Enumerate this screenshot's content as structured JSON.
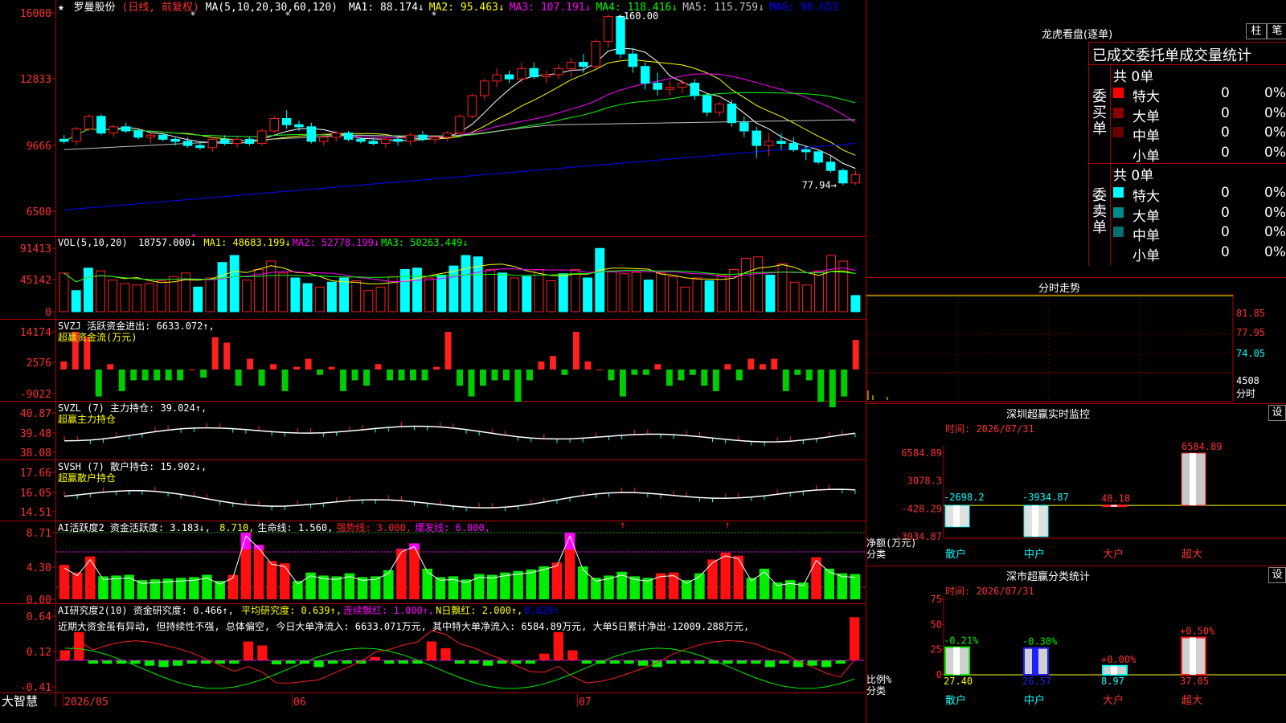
{
  "stock": {
    "star": "★",
    "name": "罗曼股份",
    "period": "(日线, 前复权)"
  },
  "price_panel": {
    "ma_header": "MA(5,10,20,30,60,120)",
    "ma_values": [
      {
        "label": "MA1: 88.174↓",
        "color": "#ffffff"
      },
      {
        "label": "MA2: 95.463↓",
        "color": "#ffff00"
      },
      {
        "label": "MA3: 107.191↓",
        "color": "#ff00ff"
      },
      {
        "label": "MA4: 118.416↓",
        "color": "#00ff00"
      },
      {
        "label": "MA5: 115.759↓",
        "color": "#c0c0c0"
      },
      {
        "label": "MA6: 98.653",
        "color": "#0000ff"
      }
    ],
    "y_labels": [
      "16000",
      "12833",
      "9666",
      "6500"
    ],
    "high_label": "160.00",
    "low_label": "77.94"
  },
  "volume_panel": {
    "header": "VOL(5,10,20)",
    "value": "18757.000↓",
    "ma_values": [
      {
        "label": "MA1: 48683.199↓",
        "color": "#ffff00"
      },
      {
        "label": "MA2: 52778.199↓",
        "color": "#ff00ff"
      },
      {
        "label": "MA3: 50263.449↓",
        "color": "#00ff00"
      }
    ],
    "y_labels": [
      "91413",
      "45142",
      "0"
    ]
  },
  "svzj_panel": {
    "header": "SVZJ  活跃资金进出: 6633.072↑,",
    "subtitle": "超赢资金流(万元)",
    "y_labels": [
      "14174",
      "2576",
      "-9022"
    ]
  },
  "svzl_panel": {
    "header": "SVZL (7) 主力持仓: 39.024↑,",
    "subtitle": "超赢主力持仓",
    "y_labels": [
      "40.87",
      "39.48",
      "38.08"
    ]
  },
  "svsh_panel": {
    "header": "SVSH (7) 散户持仓: 15.902↓,",
    "subtitle": "超赢散户持仓",
    "y_labels": [
      "17.66",
      "16.05",
      "14.51"
    ]
  },
  "ai_active_panel": {
    "header": "AI活跃度2 资金活跃度: 3.183↓,",
    "parts": [
      {
        "text": "8.710,",
        "color": "#ffff00"
      },
      {
        "text": "生命线: 1.560,",
        "color": "#ffffff"
      },
      {
        "text": "强势线: 3.000,",
        "color": "#ff2222"
      },
      {
        "text": "爆发线: 6.000,",
        "color": "#ff00ff"
      }
    ],
    "y_labels": [
      "8.71",
      "4.30",
      "0.00"
    ]
  },
  "ai_research_panel": {
    "header": "AI研究度2(10) 资金研究度: 0.466↑,",
    "parts": [
      {
        "text": "平均研究度: 0.639↑,",
        "color": "#ffff00"
      },
      {
        "text": "连续飘红: 1.000↑,",
        "color": "#ff00ff"
      },
      {
        "text": "N日飘红: 2.000↑,",
        "color": "#ffff00"
      },
      {
        "text": "0.639↑",
        "color": "#0000ff"
      }
    ],
    "commentary": "近期大资金虽有异动, 但持续性不强, 总体偏空, 今日大单净流入: 6633.071万元, 其中特大单净流入: 6584.89万元, 大单5日累计净出-12009.288万元,",
    "y_labels": [
      "0.64",
      "0.12",
      "-0.41"
    ]
  },
  "bottom_bar": {
    "brand": "大智慧",
    "dates": [
      "2026/05",
      "06",
      "07"
    ]
  },
  "right_panel": {
    "title": "龙虎看盘(逐单)",
    "btn_zhu": "柱",
    "btn_bi": "笔",
    "subtitle": "已成交委托单成交量统计",
    "buy": {
      "label": "委买单",
      "total": "共 0单",
      "rows": [
        {
          "name": "特大",
          "qty": "0",
          "pct": "0%",
          "color": "#ff0000"
        },
        {
          "name": "大单",
          "qty": "0",
          "pct": "0%",
          "color": "#8b0000"
        },
        {
          "name": "中单",
          "qty": "0",
          "pct": "0%",
          "color": "#6b0000"
        },
        {
          "name": "小单",
          "qty": "0",
          "pct": "0%",
          "color": ""
        }
      ]
    },
    "sell": {
      "label": "委卖单",
      "total": "共 0单",
      "rows": [
        {
          "name": "特大",
          "qty": "0",
          "pct": "0%",
          "color": "#00ffff"
        },
        {
          "name": "大单",
          "qty": "0",
          "pct": "0%",
          "color": "#008b8b"
        },
        {
          "name": "中单",
          "qty": "0",
          "pct": "0%",
          "color": "#007070"
        },
        {
          "name": "小单",
          "qty": "0",
          "pct": "0%",
          "color": ""
        }
      ]
    },
    "intraday": {
      "title": "分时走势",
      "y_labels": [
        "81.85",
        "77.95",
        "74.05",
        "4508",
        "分时"
      ]
    },
    "sz_monitor": {
      "title": "深圳超赢实时监控",
      "btn": "设",
      "time": "时间: 2026/07/31",
      "y_labels": [
        "6584.89",
        "3078.3",
        "-428.29",
        "-3934.87"
      ],
      "axis_note1": "净额(万元)",
      "axis_note2": "分类",
      "bars": [
        {
          "cat": "散户",
          "value": -2698.2,
          "label": "-2698.2"
        },
        {
          "cat": "中户",
          "value": -3934.87,
          "label": "-3934.87"
        },
        {
          "cat": "大户",
          "value": 48.18,
          "label": "48.18"
        },
        {
          "cat": "超大",
          "value": 6584.89,
          "label": "6584.89"
        }
      ]
    },
    "sz_class": {
      "title": "深市超赢分类统计",
      "btn": "设",
      "time": "时间: 2026/07/31",
      "y_labels": [
        "75",
        "50",
        "25",
        "0"
      ],
      "axis_note1": "比例%",
      "axis_note2": "分类",
      "bars": [
        {
          "cat": "散户",
          "value": 27.4,
          "label": "27.40",
          "change": "-0.21%"
        },
        {
          "cat": "中户",
          "value": 26.57,
          "label": "26.57",
          "change": "-0.30%"
        },
        {
          "cat": "大户",
          "value": 8.97,
          "label": "8.97",
          "change": "+0.00%"
        },
        {
          "cat": "超大",
          "value": 37.05,
          "label": "37.05",
          "change": "+0.50%"
        }
      ]
    }
  },
  "chart_data": [
    {
      "type": "candlestick",
      "title": "罗曼股份 (日线, 前复权)",
      "y_range": [
        6500,
        16000
      ],
      "ohlc": [
        [
          100,
          102,
          98,
          99
        ],
        [
          99,
          106,
          97,
          105
        ],
        [
          105,
          112,
          104,
          111
        ],
        [
          111,
          112,
          102,
          103
        ],
        [
          103,
          107,
          101,
          106
        ],
        [
          106,
          108,
          103,
          104
        ],
        [
          104,
          105,
          100,
          101
        ],
        [
          101,
          103,
          98,
          102
        ],
        [
          102,
          103,
          99,
          100
        ],
        [
          100,
          101,
          97,
          99
        ],
        [
          99,
          101,
          96,
          97
        ],
        [
          97,
          99,
          95,
          96
        ],
        [
          96,
          101,
          94,
          100
        ],
        [
          100,
          102,
          97,
          98
        ],
        [
          98,
          101,
          96,
          100
        ],
        [
          100,
          101,
          97,
          98
        ],
        [
          98,
          105,
          97,
          104
        ],
        [
          104,
          111,
          103,
          110
        ],
        [
          110,
          114,
          105,
          107
        ],
        [
          107,
          109,
          104,
          106
        ],
        [
          106,
          108,
          98,
          99
        ],
        [
          99,
          103,
          97,
          101
        ],
        [
          101,
          104,
          99,
          103
        ],
        [
          103,
          104,
          99,
          100
        ],
        [
          100,
          101,
          98,
          99
        ],
        [
          99,
          101,
          97,
          98
        ],
        [
          98,
          101,
          96,
          100
        ],
        [
          100,
          102,
          97,
          99
        ],
        [
          99,
          103,
          97,
          102
        ],
        [
          102,
          104,
          99,
          100
        ],
        [
          100,
          102,
          98,
          101
        ],
        [
          101,
          104,
          99,
          103
        ],
        [
          103,
          112,
          102,
          111
        ],
        [
          111,
          122,
          110,
          121
        ],
        [
          121,
          129,
          119,
          128
        ],
        [
          128,
          134,
          125,
          131
        ],
        [
          131,
          133,
          127,
          129
        ],
        [
          129,
          137,
          127,
          134
        ],
        [
          134,
          137,
          129,
          130
        ],
        [
          130,
          133,
          127,
          131
        ],
        [
          131,
          136,
          129,
          134
        ],
        [
          134,
          139,
          130,
          137
        ],
        [
          137,
          141,
          132,
          135
        ],
        [
          135,
          148,
          134,
          147
        ],
        [
          147,
          160,
          144,
          159
        ],
        [
          159,
          160,
          139,
          141
        ],
        [
          141,
          144,
          132,
          135
        ],
        [
          135,
          137,
          124,
          127
        ],
        [
          127,
          132,
          121,
          124
        ],
        [
          124,
          128,
          121,
          125
        ],
        [
          125,
          129,
          122,
          127
        ],
        [
          127,
          129,
          119,
          121
        ],
        [
          121,
          122,
          111,
          113
        ],
        [
          113,
          118,
          111,
          117
        ],
        [
          117,
          119,
          106,
          108
        ],
        [
          108,
          111,
          101,
          104
        ],
        [
          104,
          106,
          91,
          97
        ],
        [
          97,
          103,
          92,
          99
        ],
        [
          99,
          103,
          95,
          98
        ],
        [
          98,
          101,
          94,
          95
        ],
        [
          95,
          97,
          90,
          94
        ],
        [
          94,
          95,
          88,
          89
        ],
        [
          89,
          92,
          84,
          85
        ],
        [
          85,
          86,
          77.94,
          79
        ],
        [
          79,
          85,
          78,
          83
        ]
      ],
      "ma_series": [
        "MA1",
        "MA2",
        "MA3",
        "MA4",
        "MA5",
        "MA6"
      ]
    },
    {
      "type": "bar",
      "title": "VOL(5,10,20)",
      "values": [
        55,
        30,
        62,
        58,
        45,
        40,
        38,
        40,
        44,
        50,
        55,
        35,
        48,
        70,
        80,
        45,
        60,
        72,
        55,
        48,
        40,
        35,
        42,
        48,
        44,
        30,
        35,
        50,
        60,
        62,
        48,
        52,
        65,
        80,
        78,
        60,
        55,
        48,
        50,
        60,
        44,
        54,
        60,
        48,
        90,
        58,
        54,
        56,
        45,
        55,
        50,
        35,
        48,
        44,
        52,
        60,
        76,
        78,
        52,
        68,
        42,
        38,
        58,
        80,
        72,
        23
      ],
      "up": [
        false,
        true,
        true,
        false,
        false,
        false,
        false,
        false,
        false,
        false,
        false,
        true,
        false,
        true,
        true,
        false,
        false,
        false,
        false,
        true,
        true,
        false,
        true,
        true,
        false,
        false,
        false,
        false,
        true,
        true,
        false,
        true,
        true,
        true,
        true,
        false,
        true,
        false,
        true,
        false,
        false,
        true,
        false,
        true,
        true,
        false,
        false,
        false,
        true,
        false,
        false,
        false,
        false,
        true,
        false,
        false,
        false,
        false,
        true,
        false,
        false,
        false,
        false,
        false,
        false,
        true
      ]
    },
    {
      "type": "bar",
      "title": "SVZJ 活跃资金进出",
      "values": [
        3,
        14,
        12,
        -10,
        2,
        -8,
        -4,
        -4,
        -4,
        -4,
        -4,
        0,
        -3,
        12,
        10,
        -6,
        4,
        -6,
        2,
        -8,
        1,
        4,
        -2,
        1,
        -8,
        -4,
        -6,
        2,
        -4,
        -4,
        -4,
        -4,
        1,
        14,
        -6,
        -10,
        -6,
        -4,
        -4,
        -12,
        -4,
        3,
        5,
        -2,
        14,
        3,
        0,
        -4,
        -10,
        -2,
        -2,
        2,
        -6,
        -4,
        -2,
        -6,
        -8,
        2,
        -4,
        4,
        2,
        4,
        -8,
        -2,
        -4,
        -12,
        -14,
        -10,
        11
      ]
    },
    {
      "type": "line",
      "title": "SVZL 主力持仓",
      "y_range": [
        38.08,
        40.87
      ]
    },
    {
      "type": "line",
      "title": "SVSH 散户持仓",
      "y_range": [
        14.51,
        17.66
      ]
    },
    {
      "type": "bar",
      "title": "AI活跃度2",
      "values": [
        4.5,
        3.5,
        5.6,
        3.0,
        3.1,
        3.2,
        2.5,
        2.6,
        2.7,
        2.8,
        2.9,
        3.2,
        2.4,
        3.2,
        8.7,
        7.1,
        5.0,
        4.7,
        2.4,
        3.5,
        3.1,
        3.0,
        3.4,
        2.9,
        3.0,
        3.8,
        6.6,
        7.3,
        4.0,
        2.9,
        3.0,
        2.6,
        3.3,
        3.2,
        3.5,
        3.7,
        3.9,
        4.3,
        4.8,
        8.7,
        4.3,
        2.8,
        3.1,
        3.6,
        3.0,
        2.8,
        3.4,
        3.5,
        2.5,
        3.4,
        5.2,
        6.1,
        5.7,
        2.8,
        4.0,
        2.2,
        2.5,
        2.2,
        5.5,
        4.0,
        3.4,
        3.3
      ],
      "y_range": [
        0,
        8.71
      ]
    },
    {
      "type": "bar",
      "title": "AI研究度2(10)",
      "values": [
        0.15,
        0.42,
        -0.05,
        -0.05,
        -0.05,
        -0.05,
        -0.08,
        -0.1,
        -0.08,
        -0.05,
        -0.05,
        -0.05,
        -0.05,
        0.28,
        0.22,
        -0.06,
        -0.05,
        -0.05,
        -0.1,
        -0.05,
        -0.05,
        -0.05,
        0.05,
        -0.05,
        -0.05,
        -0.05,
        0.28,
        0.18,
        -0.05,
        -0.05,
        -0.08,
        -0.05,
        -0.05,
        -0.05,
        0.1,
        0.42,
        0.15,
        -0.05,
        -0.05,
        -0.05,
        -0.05,
        -0.08,
        -0.1,
        -0.05,
        -0.05,
        -0.05,
        -0.05,
        -0.05,
        -0.05,
        -0.05,
        -0.1,
        -0.05,
        -0.1,
        -0.08,
        -0.1,
        -0.05,
        0.64
      ],
      "y_range": [
        -0.41,
        0.64
      ]
    }
  ]
}
